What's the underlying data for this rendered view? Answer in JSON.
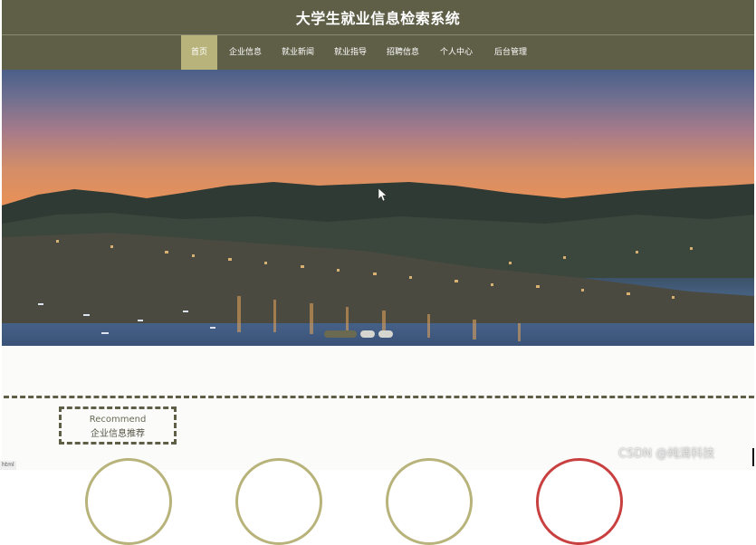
{
  "header": {
    "title": "大学生就业信息检索系统"
  },
  "nav": {
    "items": [
      {
        "label": "首页",
        "active": true
      },
      {
        "label": "企业信息",
        "active": false
      },
      {
        "label": "就业新闻",
        "active": false
      },
      {
        "label": "就业指导",
        "active": false
      },
      {
        "label": "招聘信息",
        "active": false
      },
      {
        "label": "个人中心",
        "active": false
      },
      {
        "label": "后台管理",
        "active": false
      }
    ]
  },
  "carousel": {
    "slide_count": 3,
    "active_index": 0
  },
  "section": {
    "title_en": "Recommend",
    "title_cn": "企业信息推荐"
  },
  "status_bar": {
    "text": "html"
  },
  "watermark": {
    "text": "CSDN @纯清科技"
  },
  "colors": {
    "header_bg": "#5f5f48",
    "nav_active_bg": "#b8b37a",
    "accent_red": "#c94040"
  }
}
